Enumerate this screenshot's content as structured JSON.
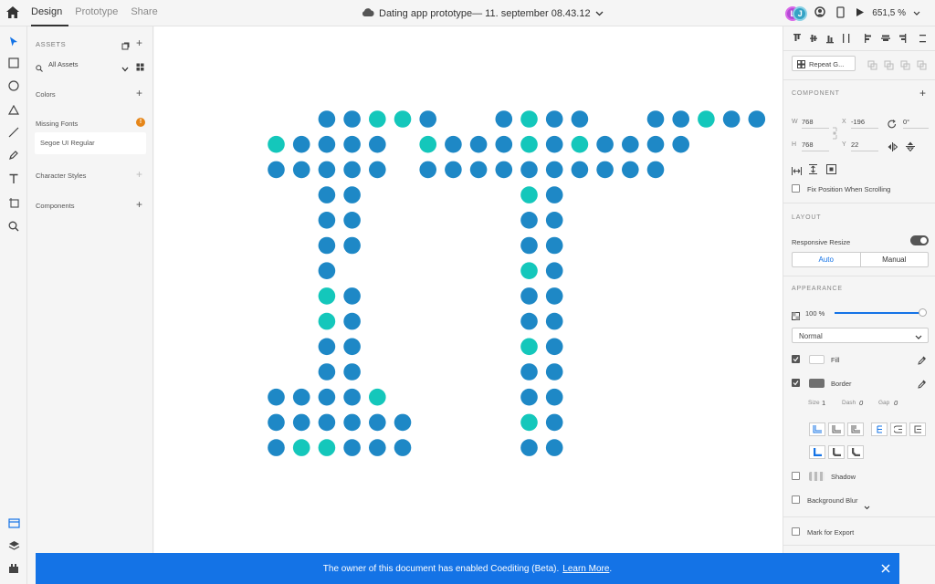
{
  "header": {
    "tabs": [
      {
        "label": "Design"
      },
      {
        "label": "Prototype"
      },
      {
        "label": "Share"
      }
    ],
    "document_title": "Dating app prototype— 11. september 08.43.12",
    "zoom": "651,5 %",
    "avatars": [
      "L",
      "J"
    ]
  },
  "assets": {
    "title": "ASSETS",
    "filter": "All Assets",
    "colors_label": "Colors",
    "missing_fonts_label": "Missing Fonts",
    "missing_font": "Segoe UI Regular",
    "character_styles_label": "Character Styles",
    "components_label": "Components"
  },
  "inspector": {
    "repeat_grid": "Repeat G...",
    "component_label": "COMPONENT",
    "w_label": "W",
    "w_value": "768",
    "h_label": "H",
    "h_value": "768",
    "x_label": "X",
    "x_value": "-196",
    "y_label": "Y",
    "y_value": "22",
    "rotation": "0°",
    "fix_position": "Fix Position When Scrolling",
    "layout_label": "LAYOUT",
    "responsive_resize": "Responsive Resize",
    "auto": "Auto",
    "manual": "Manual",
    "appearance_label": "APPEARANCE",
    "opacity": "100 %",
    "blend_mode": "Normal",
    "fill": "Fill",
    "border": "Border",
    "size_label": "Size",
    "size_value": "1",
    "dash_label": "Dash",
    "dash_value": "0",
    "gap_label": "Gap",
    "gap_value": "0",
    "shadow": "Shadow",
    "background_blur": "Background Blur",
    "mark_for_export": "Mark for Export"
  },
  "banner": {
    "message": "The owner of this document has enabled Coediting (Beta).",
    "link": "Learn More",
    "period": "."
  },
  "colors": {
    "blue_dot": "#1e88c6",
    "teal_dot": "#14c7bb",
    "accent": "#1473e6"
  }
}
